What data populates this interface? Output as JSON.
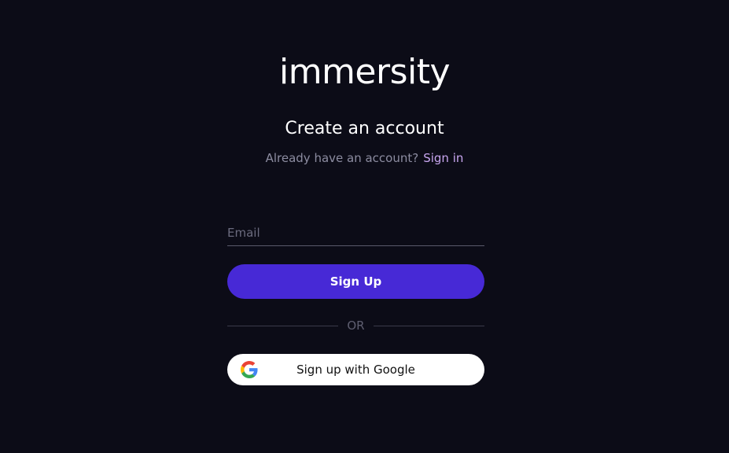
{
  "brand": {
    "logo_text": "immersity"
  },
  "auth": {
    "title": "Create an account",
    "signin_prompt": "Already have an account?",
    "signin_link": "Sign in",
    "email_placeholder": "Email",
    "email_value": "",
    "signup_label": "Sign Up",
    "divider_label": "OR",
    "google_label": "Sign up with Google"
  },
  "colors": {
    "background": "#0c0c17",
    "primary_button": "#4729d6",
    "link": "#c8a6f0"
  },
  "icons": {
    "google": "google-icon"
  }
}
